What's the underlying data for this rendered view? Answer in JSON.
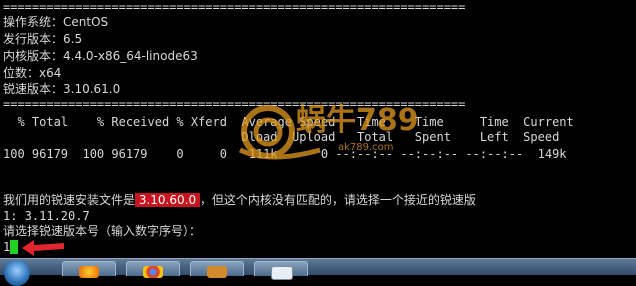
{
  "terminal": {
    "separator": "================================================================",
    "sysinfo": [
      "操作系统：CentOS",
      "发行版本：6.5",
      "内核版本：4.4.0-x86_64-linode63",
      "位数：x64",
      "锐速版本：3.10.61.0"
    ],
    "curl_header_1": "  % Total    % Received % Xferd  Average Speed   Time    Time     Time  Current",
    "curl_header_2": "                                 Dload  Upload   Total   Spent    Left  Speed",
    "curl_progress": "100 96179  100 96179    0     0   111k      0 --:--:-- --:--:-- --:--:--  149k",
    "msg_prefix": "我们用的锐速安装文件是",
    "msg_version": " 3.10.60.0 ",
    "msg_suffix": "，但这个内核没有匹配的，请选择一个接近的锐速版",
    "option_1": "1: 3.11.20.7",
    "prompt": "请选择锐速版本号（输入数字序号）：",
    "input_value": "1"
  },
  "watermark": {
    "brand": "蜗牛789",
    "url": "ak789.com"
  },
  "colors": {
    "terminal_bg": "#000000",
    "terminal_fg": "#d8d8d8",
    "highlight_bg": "#c8141e",
    "cursor": "#21d321",
    "annotation_arrow": "#e0262e"
  },
  "taskbar": {
    "items": [
      "start-orb",
      "firefox-icon",
      "chrome-icon",
      "xshell-icon",
      "file-icon"
    ]
  }
}
